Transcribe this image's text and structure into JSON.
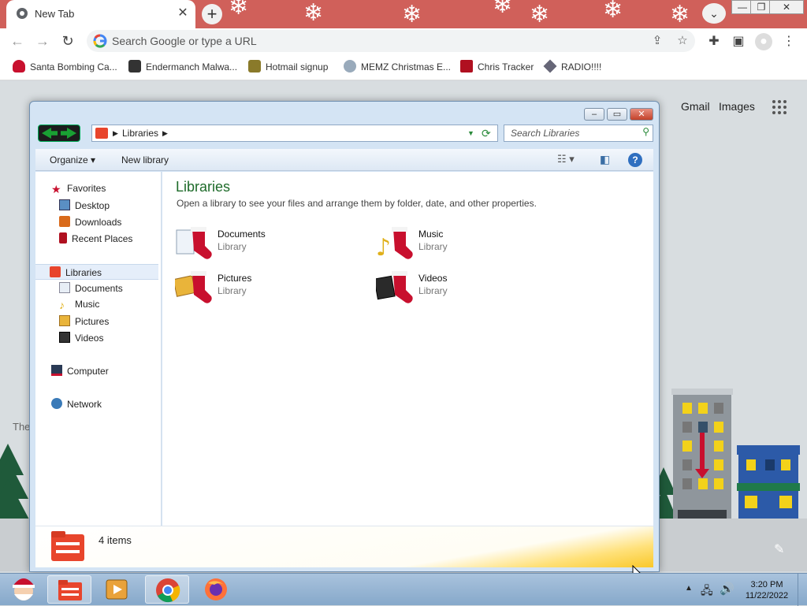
{
  "browser": {
    "tab": {
      "title": "New Tab"
    },
    "omnibox": {
      "placeholder": "Search Google or type a URL"
    },
    "bookmarks": [
      {
        "label": "Santa Bombing Ca...",
        "icon": "santa-icon"
      },
      {
        "label": "Endermanch Malwa...",
        "icon": "figure-icon"
      },
      {
        "label": "Hotmail signup",
        "icon": "trophy-icon"
      },
      {
        "label": "MEMZ Christmas E...",
        "icon": "snowman-icon"
      },
      {
        "label": "Chris Tracker",
        "icon": "ornament-icon"
      },
      {
        "label": "RADIO!!!!",
        "icon": "radio-icon"
      }
    ]
  },
  "google": {
    "links": {
      "gmail": "Gmail",
      "images": "Images"
    },
    "footer_fragment": "The"
  },
  "explorer": {
    "address": {
      "root": "Libraries"
    },
    "search_placeholder": "Search Libraries",
    "commands": {
      "organize": "Organize",
      "new_library": "New library"
    },
    "nav": {
      "favorites": "Favorites",
      "favorites_items": [
        "Desktop",
        "Downloads",
        "Recent Places"
      ],
      "libraries": "Libraries",
      "libraries_items": [
        "Documents",
        "Music",
        "Pictures",
        "Videos"
      ],
      "computer": "Computer",
      "network": "Network"
    },
    "content": {
      "title": "Libraries",
      "subtitle": "Open a library to see your files and arrange them by folder, date, and other properties.",
      "libraries": [
        {
          "name": "Documents",
          "type": "Library"
        },
        {
          "name": "Music",
          "type": "Library"
        },
        {
          "name": "Pictures",
          "type": "Library"
        },
        {
          "name": "Videos",
          "type": "Library"
        }
      ]
    },
    "details": {
      "count": "4 items"
    }
  },
  "taskbar": {
    "time": "3:20 PM",
    "date": "11/22/2022"
  },
  "colors": {
    "chrome_tab_strip": "#d0605a",
    "library_title": "#1e6b2a",
    "stocking_red": "#c8102e"
  }
}
